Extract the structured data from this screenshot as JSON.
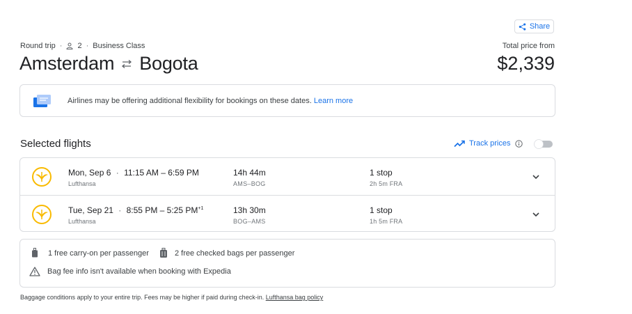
{
  "header": {
    "share_label": "Share",
    "trip_type": "Round trip",
    "passengers": "2",
    "cabin_class": "Business Class",
    "origin": "Amsterdam",
    "destination": "Bogota",
    "total_price_label": "Total price from",
    "total_price": "$2,339"
  },
  "notice": {
    "text": "Airlines may be offering additional flexibility for bookings on these dates.",
    "link_label": "Learn more"
  },
  "selected_flights": {
    "title": "Selected flights",
    "track_prices_label": "Track prices",
    "track_prices_enabled": false,
    "flights": [
      {
        "date": "Mon, Sep 6",
        "times": "11:15 AM – 6:59 PM",
        "day_offset": "",
        "airline": "Lufthansa",
        "duration": "14h 44m",
        "route": "AMS–BOG",
        "stops": "1 stop",
        "layover": "2h 5m FRA"
      },
      {
        "date": "Tue, Sep 21",
        "times": "8:55 PM – 5:25 PM",
        "day_offset": "+1",
        "airline": "Lufthansa",
        "duration": "13h 30m",
        "route": "BOG–AMS",
        "stops": "1 stop",
        "layover": "1h 5m FRA"
      }
    ]
  },
  "baggage": {
    "carry_on": "1 free carry-on per passenger",
    "checked": "2 free checked bags per passenger",
    "warning": "Bag fee info isn't available when booking with Expedia"
  },
  "footer": {
    "text": "Baggage conditions apply to your entire trip. Fees may be higher if paid during check-in.",
    "link_label": "Lufthansa bag policy"
  },
  "colors": {
    "accent": "#1a73e8",
    "lufthansa_yellow": "#f9ba00",
    "border": "#dadce0"
  }
}
